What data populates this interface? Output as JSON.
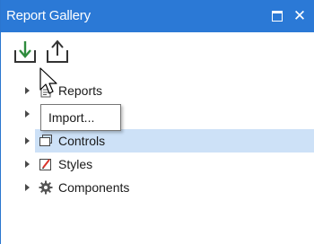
{
  "window": {
    "title": "Report Gallery",
    "maximize_icon": "maximize-icon",
    "close_glyph": "✕"
  },
  "toolbar": {
    "import_icon": "import-arrow-icon",
    "export_icon": "export-arrow-icon",
    "import_tooltip": "Import..."
  },
  "tree": {
    "items": [
      {
        "label": "Reports",
        "icon": "reports-icon",
        "selected": false
      },
      {
        "label": "",
        "icon": "",
        "selected": false
      },
      {
        "label": "Controls",
        "icon": "controls-icon",
        "selected": true
      },
      {
        "label": "Styles",
        "icon": "styles-icon",
        "selected": false
      },
      {
        "label": "Components",
        "icon": "gear-icon",
        "selected": false
      }
    ]
  },
  "colors": {
    "titlebar": "#2b79d6",
    "selection": "#cde1f7",
    "import_arrow": "#2e8b3d",
    "styles_accent": "#d9342b"
  }
}
